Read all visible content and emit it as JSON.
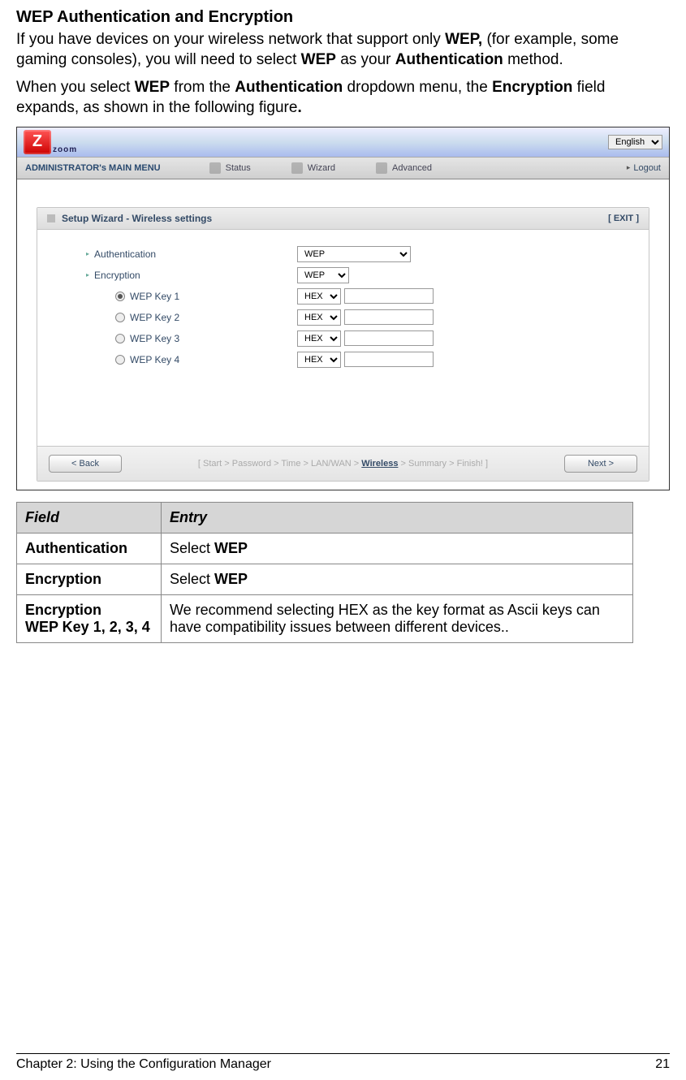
{
  "section_title": "WEP Authentication and Encryption",
  "para1_pre": "If you have devices on your wireless network that support only ",
  "para1_wep": "WEP,",
  "para1_mid": " (for example, some gaming consoles), you will need to select ",
  "para1_wep2": "WEP",
  "para1_mid2": " as your ",
  "para1_auth": "Authentication",
  "para1_end": " method.",
  "para2_pre": "When you select ",
  "para2_wep": "WEP",
  "para2_mid": " from the ",
  "para2_auth": "Authentication",
  "para2_mid2": " dropdown menu, the ",
  "para2_enc": "Encryption",
  "para2_end": " field expands, as shown in the following figure",
  "para2_period": ".",
  "screenshot": {
    "lang": "English",
    "logo_letter": "Z",
    "brand": "zoom",
    "menu_title": "ADMINISTRATOR's MAIN MENU",
    "menu_status": "Status",
    "menu_wizard": "Wizard",
    "menu_advanced": "Advanced",
    "menu_logout": "Logout",
    "wizard_title": "Setup Wizard - Wireless settings",
    "exit": "[ EXIT ]",
    "form": {
      "auth_label": "Authentication",
      "auth_value": "WEP",
      "enc_label": "Encryption",
      "enc_value": "WEP",
      "keys": [
        {
          "label": "WEP Key 1",
          "fmt": "HEX",
          "checked": true
        },
        {
          "label": "WEP Key 2",
          "fmt": "HEX",
          "checked": false
        },
        {
          "label": "WEP Key 3",
          "fmt": "HEX",
          "checked": false
        },
        {
          "label": "WEP Key 4",
          "fmt": "HEX",
          "checked": false
        }
      ]
    },
    "back": "< Back",
    "next": "Next >",
    "crumbs": {
      "open": "[ ",
      "start": "Start",
      "password": "Password",
      "time": "Time",
      "lanwan": "LAN/WAN",
      "wireless": "Wireless",
      "summary": "Summary",
      "finish": "Finish!",
      "close": " ]"
    }
  },
  "table": {
    "h_field": "Field",
    "h_entry": "Entry",
    "rows": [
      {
        "field": "Authentication",
        "entry_pre": "Select ",
        "entry_bold": "WEP",
        "entry_post": ""
      },
      {
        "field": "Encryption",
        "entry_pre": "Select ",
        "entry_bold": "WEP",
        "entry_post": ""
      }
    ],
    "row3_field_l1": "Encryption",
    "row3_field_l2": "WEP Key 1, 2, 3, 4",
    "row3_entry": "We recommend selecting HEX as the key format as Ascii keys can have compatibility issues between different devices.."
  },
  "footer": {
    "left": "Chapter 2: Using the Configuration Manager",
    "right": "21"
  }
}
